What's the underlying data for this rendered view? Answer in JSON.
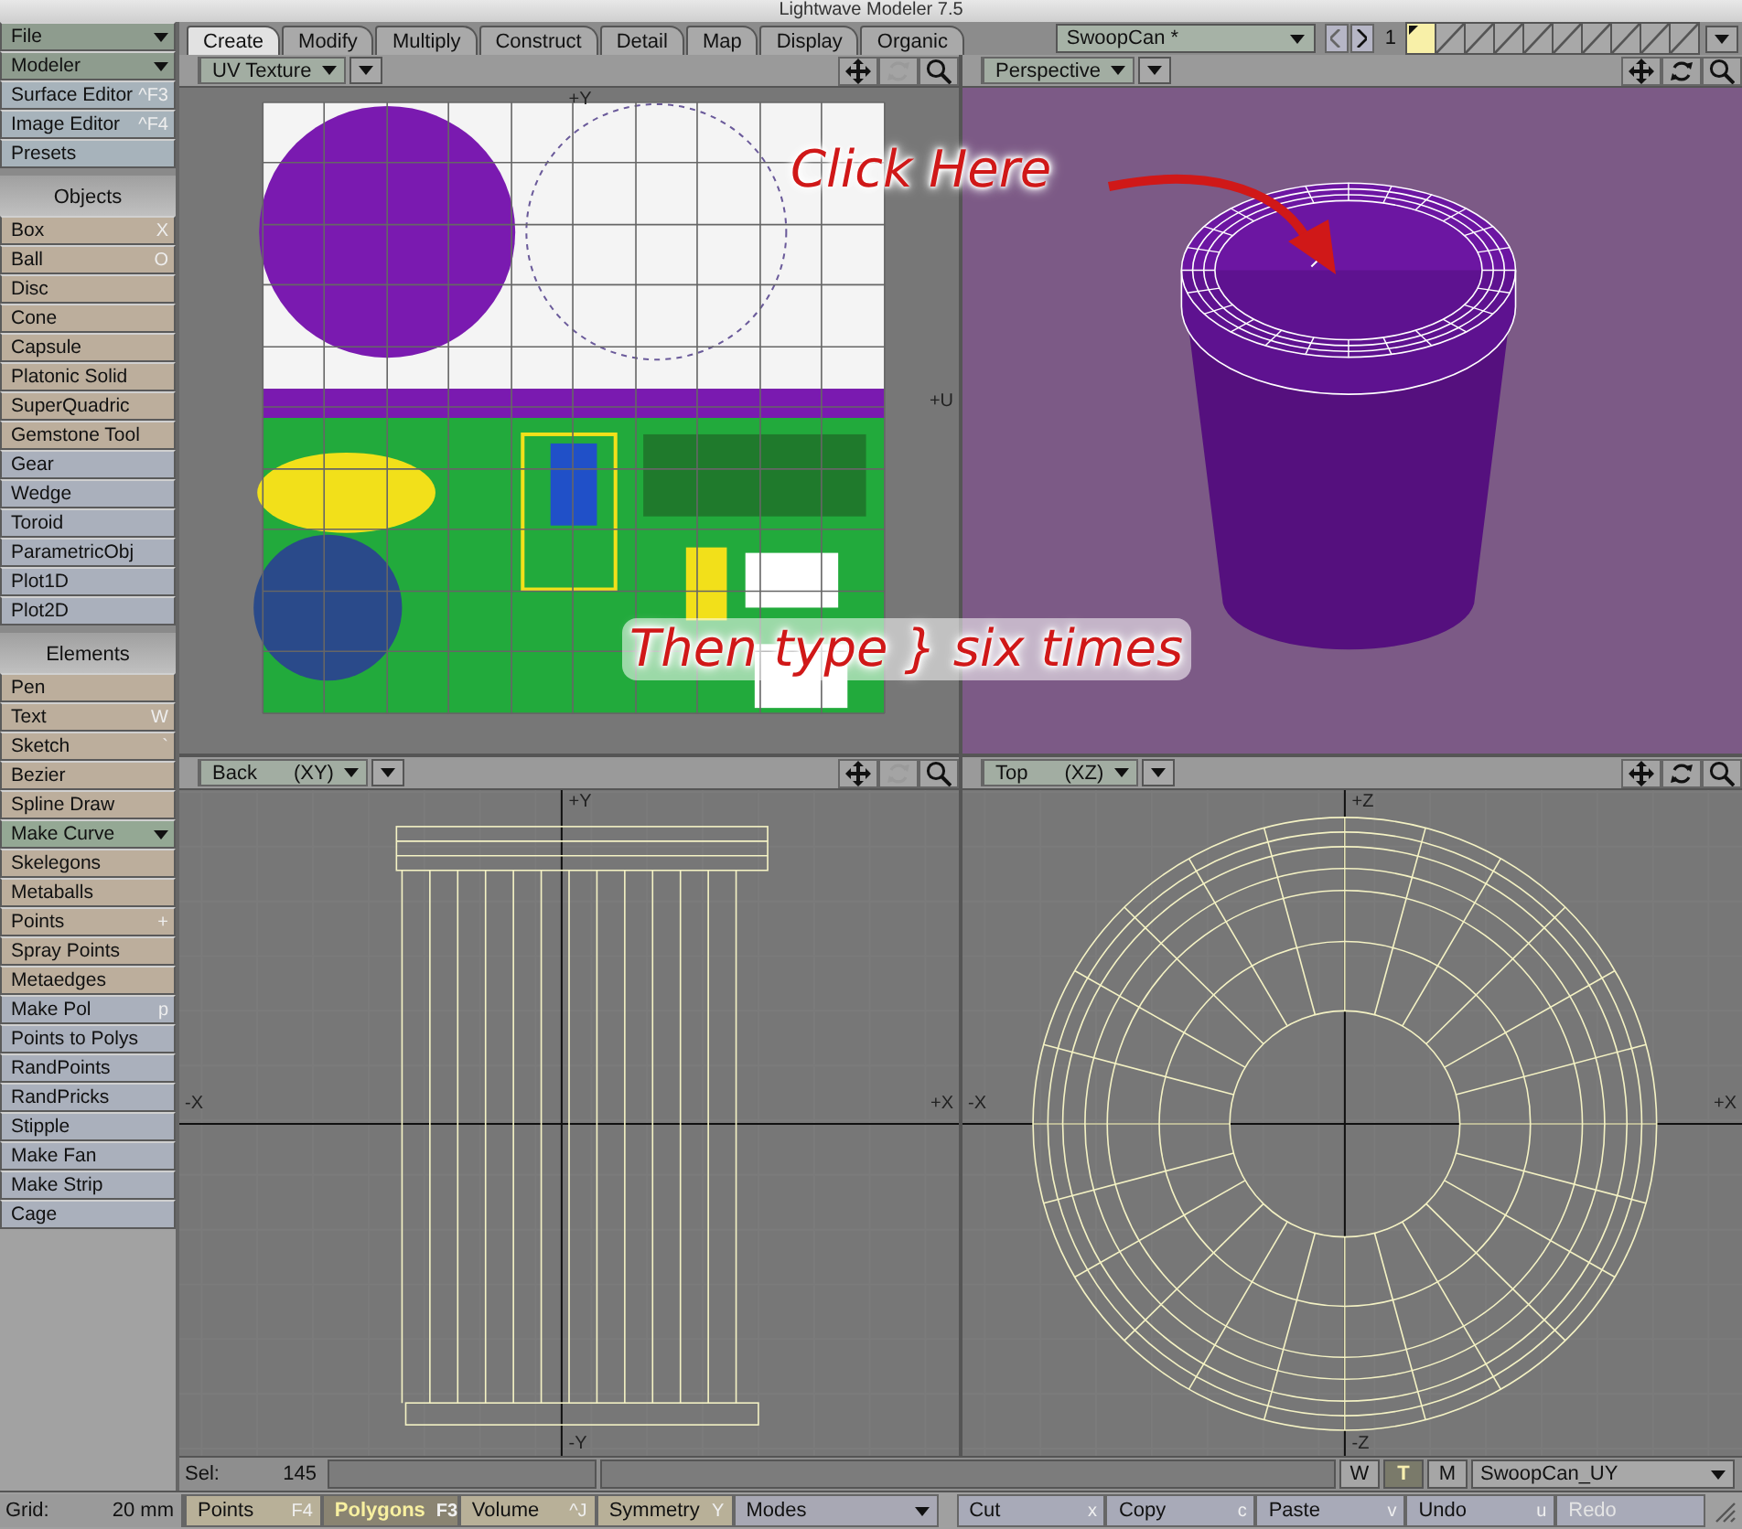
{
  "window": {
    "title": "Lightwave Modeler 7.5"
  },
  "sidebar": {
    "items": [
      {
        "kind": "dropdown",
        "label": "File",
        "color": "#8e9c8e"
      },
      {
        "kind": "dropdown",
        "label": "Modeler",
        "color": "#8e9c8e"
      },
      {
        "kind": "tool",
        "label": "Surface Editor",
        "shortcut": "^F3",
        "color": "#a7b3bb"
      },
      {
        "kind": "tool",
        "label": "Image Editor",
        "shortcut": "^F4",
        "color": "#a7b3bb"
      },
      {
        "kind": "tool",
        "label": "Presets",
        "color": "#a7b3bb"
      },
      {
        "kind": "header",
        "label": "Objects"
      },
      {
        "kind": "tool",
        "label": "Box",
        "shortcut": "X",
        "color": "#bcae9c"
      },
      {
        "kind": "tool",
        "label": "Ball",
        "shortcut": "O",
        "color": "#bcae9c"
      },
      {
        "kind": "tool",
        "label": "Disc",
        "color": "#bcae9c"
      },
      {
        "kind": "tool",
        "label": "Cone",
        "color": "#bcae9c"
      },
      {
        "kind": "tool",
        "label": "Capsule",
        "color": "#bcae9c"
      },
      {
        "kind": "tool",
        "label": "Platonic Solid",
        "color": "#bcae9c"
      },
      {
        "kind": "tool",
        "label": "SuperQuadric",
        "color": "#bcae9c"
      },
      {
        "kind": "tool",
        "label": "Gemstone Tool",
        "color": "#bcae9c"
      },
      {
        "kind": "tool",
        "label": "Gear",
        "color": "#aab0bc"
      },
      {
        "kind": "tool",
        "label": "Wedge",
        "color": "#aab0bc"
      },
      {
        "kind": "tool",
        "label": "Toroid",
        "color": "#aab0bc"
      },
      {
        "kind": "tool",
        "label": "ParametricObj",
        "color": "#aab0bc"
      },
      {
        "kind": "tool",
        "label": "Plot1D",
        "color": "#aab0bc"
      },
      {
        "kind": "tool",
        "label": "Plot2D",
        "color": "#aab0bc"
      },
      {
        "kind": "header",
        "label": "Elements"
      },
      {
        "kind": "tool",
        "label": "Pen",
        "color": "#bcae9c"
      },
      {
        "kind": "tool",
        "label": "Text",
        "shortcut": "W",
        "color": "#bcae9c"
      },
      {
        "kind": "tool",
        "label": "Sketch",
        "shortcut": "`",
        "color": "#bcae9c"
      },
      {
        "kind": "tool",
        "label": "Bezier",
        "color": "#bcae9c"
      },
      {
        "kind": "tool",
        "label": "Spline Draw",
        "color": "#bcae9c"
      },
      {
        "kind": "dropdown",
        "label": "Make Curve",
        "color": "#94a894"
      },
      {
        "kind": "tool",
        "label": "Skelegons",
        "color": "#bcae9c"
      },
      {
        "kind": "tool",
        "label": "Metaballs",
        "color": "#bcae9c"
      },
      {
        "kind": "tool",
        "label": "Points",
        "shortcut": "+",
        "color": "#bcae9c"
      },
      {
        "kind": "tool",
        "label": "Spray Points",
        "color": "#bcae9c"
      },
      {
        "kind": "tool",
        "label": "Metaedges",
        "color": "#bcae9c"
      },
      {
        "kind": "tool",
        "label": "Make Pol",
        "shortcut": "p",
        "color": "#aab0bc"
      },
      {
        "kind": "tool",
        "label": "Points to Polys",
        "color": "#aab0bc"
      },
      {
        "kind": "tool",
        "label": "RandPoints",
        "color": "#aab0bc"
      },
      {
        "kind": "tool",
        "label": "RandPricks",
        "color": "#aab0bc"
      },
      {
        "kind": "tool",
        "label": "Stipple",
        "color": "#aab0bc"
      },
      {
        "kind": "tool",
        "label": "Make Fan",
        "color": "#aab0bc"
      },
      {
        "kind": "tool",
        "label": "Make Strip",
        "color": "#aab0bc"
      },
      {
        "kind": "tool",
        "label": "Cage",
        "color": "#aab0bc"
      }
    ]
  },
  "tabs": [
    {
      "label": "Create",
      "selected": true
    },
    {
      "label": "Modify",
      "selected": false
    },
    {
      "label": "Multiply",
      "selected": false
    },
    {
      "label": "Construct",
      "selected": false
    },
    {
      "label": "Detail",
      "selected": false
    },
    {
      "label": "Map",
      "selected": false
    },
    {
      "label": "Display",
      "selected": false
    },
    {
      "label": "Organic",
      "selected": false
    }
  ],
  "object_bar": {
    "object": "SwoopCan *",
    "layer_number": "1",
    "layers": [
      {
        "selected": true
      },
      {
        "selected": false
      },
      {
        "selected": false
      },
      {
        "selected": false
      },
      {
        "selected": false
      },
      {
        "selected": false
      },
      {
        "selected": false
      },
      {
        "selected": false
      },
      {
        "selected": false
      },
      {
        "selected": false
      }
    ]
  },
  "viewports": [
    {
      "kind": "uv",
      "view": "UV Texture",
      "rotate_disabled": true,
      "axis_labels": {
        "top": "+Y",
        "right": "+U"
      }
    },
    {
      "kind": "perspective",
      "view": "Perspective",
      "rotate_disabled": false
    },
    {
      "kind": "back",
      "view": "Back",
      "projection": "(XY)",
      "rotate_disabled": true,
      "axis_labels": {
        "top": "+Y",
        "left": "-X",
        "right": "+X",
        "bottom": "-Y"
      }
    },
    {
      "kind": "top",
      "view": "Top",
      "projection": "(XZ)",
      "rotate_disabled": false,
      "axis_labels": {
        "top": "+Z",
        "left": "-X",
        "right": "+X",
        "bottom": "-Z"
      }
    }
  ],
  "annotations": [
    {
      "text": "Click Here"
    },
    {
      "text": "Then type } six times"
    }
  ],
  "status": {
    "sel_label": "Sel:",
    "sel_value": "145",
    "modes": [
      {
        "label": "W",
        "selected": false
      },
      {
        "label": "T",
        "selected": true
      },
      {
        "label": "M",
        "selected": false
      }
    ],
    "surface": "SwoopCan_UY"
  },
  "bottom_bar": {
    "grid_label": "Grid:",
    "grid_value": "20 mm",
    "buttons": [
      {
        "kind": "toggle",
        "label": "Points",
        "shortcut": "F4",
        "selected": false
      },
      {
        "kind": "toggle",
        "label": "Polygons",
        "shortcut": "F3",
        "selected": true
      },
      {
        "kind": "toggle",
        "label": "Volume",
        "shortcut": "^J",
        "selected": false
      },
      {
        "kind": "toggle",
        "label": "Symmetry",
        "shortcut": "Y",
        "selected": false
      },
      {
        "kind": "dropdown",
        "label": "Modes"
      },
      {
        "kind": "action",
        "label": "Cut",
        "shortcut": "x",
        "disabled": false
      },
      {
        "kind": "action",
        "label": "Copy",
        "shortcut": "c",
        "disabled": false
      },
      {
        "kind": "action",
        "label": "Paste",
        "shortcut": "v",
        "disabled": false
      },
      {
        "kind": "action",
        "label": "Undo",
        "shortcut": "u",
        "disabled": false
      },
      {
        "kind": "action",
        "label": "Redo",
        "disabled": true
      }
    ]
  }
}
